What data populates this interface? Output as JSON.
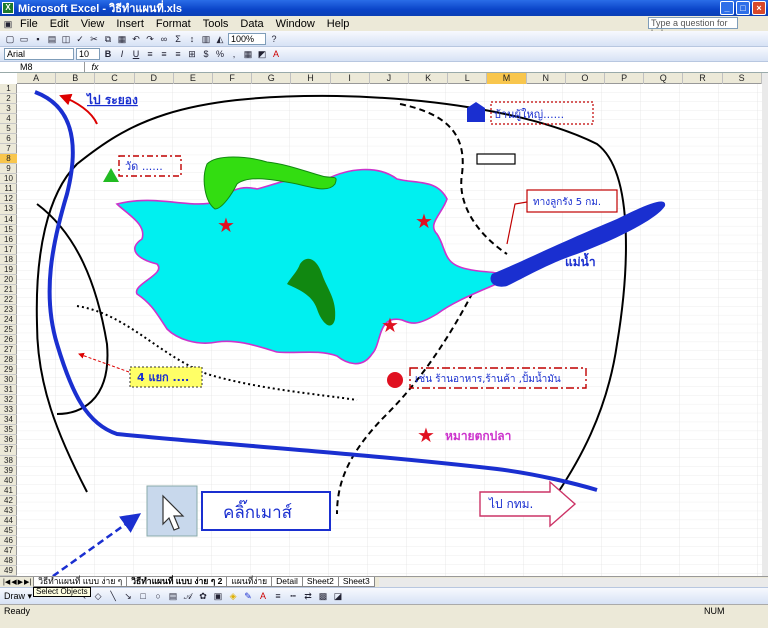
{
  "window": {
    "title": "Microsoft Excel - วิธีทำแผนที่.xls"
  },
  "menu": [
    "File",
    "Edit",
    "View",
    "Insert",
    "Format",
    "Tools",
    "Data",
    "Window",
    "Help"
  ],
  "help_box": {
    "placeholder": "Type a question for help"
  },
  "toolbar": {
    "zoom": "100%",
    "font": "Arial",
    "font_size": "10",
    "bold": "B",
    "italic": "I",
    "underline": "U"
  },
  "formula_bar": {
    "name_box": "M8",
    "fx": "fx"
  },
  "columns": [
    "A",
    "B",
    "C",
    "D",
    "E",
    "F",
    "G",
    "H",
    "I",
    "J",
    "K",
    "L",
    "M",
    "N",
    "O",
    "P",
    "Q",
    "R",
    "S"
  ],
  "selected_column": "M",
  "rows": [
    "1",
    "2",
    "3",
    "4",
    "5",
    "6",
    "7",
    "8",
    "9",
    "10",
    "11",
    "12",
    "13",
    "14",
    "15",
    "16",
    "17",
    "18",
    "19",
    "20",
    "21",
    "22",
    "23",
    "24",
    "25",
    "26",
    "27",
    "28",
    "29",
    "30",
    "31",
    "32",
    "33",
    "34",
    "35",
    "36",
    "37",
    "38",
    "39",
    "40",
    "41",
    "42",
    "43",
    "44",
    "45",
    "46",
    "47",
    "48",
    "49"
  ],
  "selected_row": "8",
  "map": {
    "to_rayong": "ไป ระยอง",
    "village_head": "บ้านผู้ใหญ่......",
    "temple": "วัด ......",
    "road_distance": "ทางลูกรัง 5 กม.",
    "river": "แม่น้ำ",
    "shops": "เช่น ร้านอาหาร,ร้านค้า ,ปั้มน้ำมัน",
    "intersection": "4 แยก ....",
    "fishing_spot": "หมายตกปลา",
    "to_bangkok": "ไป กทม.",
    "click_mouse": "คลิ๊กเมาส์"
  },
  "sheet_tabs": [
    "วิธีทำแผนที่ แบบ ง่าย ๆ",
    "วิธีทำแผนที่ แบบ ง่าย ๆ 2",
    "แผนที่ง่าย",
    "Detail",
    "Sheet2",
    "Sheet3"
  ],
  "active_tab_index": 1,
  "drawing_toolbar": {
    "draw": "Draw ▾",
    "tooltip": "Select Objects"
  },
  "status": {
    "ready": "Ready",
    "num": "NUM"
  }
}
